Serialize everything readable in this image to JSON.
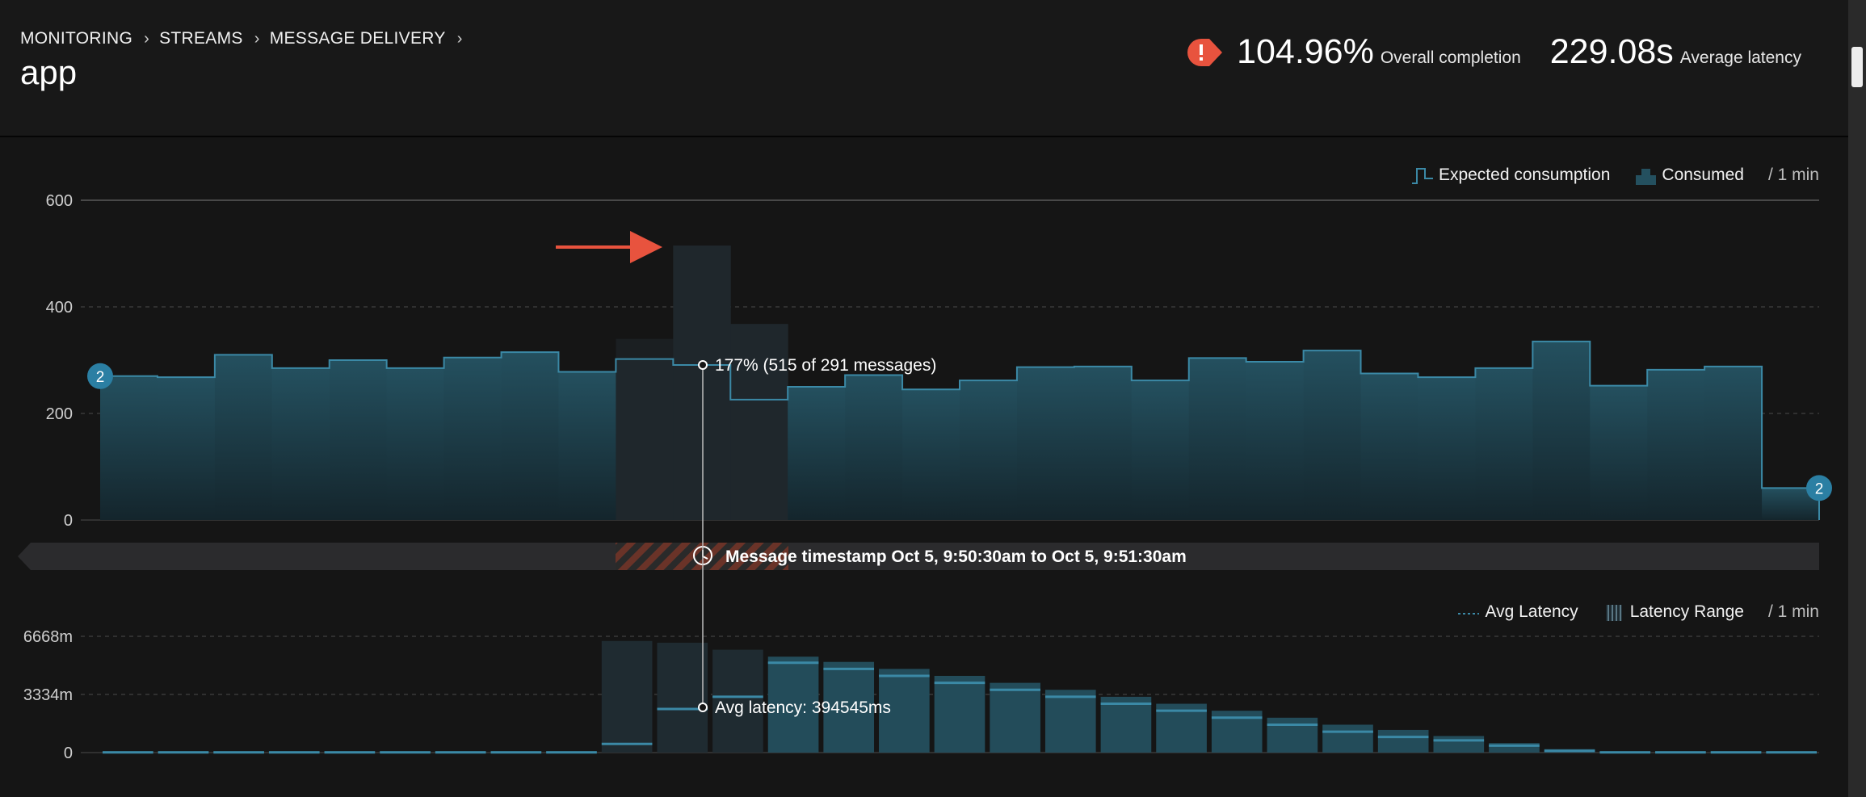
{
  "breadcrumb": [
    "MONITORING",
    "STREAMS",
    "MESSAGE DELIVERY"
  ],
  "page_title": "app",
  "stats": {
    "completion_value": "104.96%",
    "completion_label": "Overall completion",
    "latency_value": "229.08s",
    "latency_label": "Average latency"
  },
  "top_legend": {
    "expected": "Expected consumption",
    "consumed": "Consumed",
    "per": "/ 1 min"
  },
  "bottom_legend": {
    "avg": "Avg Latency",
    "range": "Latency Range",
    "per": "/ 1 min"
  },
  "timestamp_bar": "Message timestamp Oct 5, 9:50:30am to Oct 5, 9:51:30am",
  "tooltip_top": "177% (515 of 291 messages)",
  "tooltip_bottom": "Avg latency: 394545ms",
  "markers": [
    "2",
    "2"
  ],
  "colors": {
    "bar_top": "#24505f",
    "bar_bottom": "#173039",
    "line": "#3b89a6",
    "highlight": "#1f272c",
    "alert": "#e8533e",
    "marker": "#2b7fa3"
  },
  "chart_data": [
    {
      "type": "bar",
      "ylim": [
        0,
        600
      ],
      "yticks": [
        "600",
        "400",
        "200",
        "0"
      ],
      "ytick_values": [
        600,
        400,
        200,
        0
      ],
      "consumed": [
        270,
        268,
        310,
        285,
        300,
        285,
        305,
        315,
        278,
        302,
        515,
        368,
        250,
        272,
        245,
        262,
        287,
        288,
        262,
        304,
        297,
        318,
        275,
        268,
        285,
        335,
        252,
        282,
        288,
        60
      ],
      "expected": [
        270,
        268,
        310,
        285,
        300,
        285,
        305,
        315,
        278,
        302,
        291,
        226,
        250,
        272,
        245,
        262,
        287,
        288,
        262,
        304,
        297,
        318,
        275,
        268,
        285,
        335,
        252,
        282,
        288,
        60
      ],
      "highlight_index": 10
    },
    {
      "type": "bar",
      "unit": "ms",
      "ylim": [
        0,
        6668000
      ],
      "yticks": [
        "6668m",
        "3334m",
        "0"
      ],
      "ytick_values": [
        6668000,
        3334000,
        0
      ],
      "latency_max": [
        80000,
        80000,
        80000,
        80000,
        80000,
        80000,
        80000,
        80000,
        80000,
        6400000,
        6300000,
        5900000,
        5500000,
        5200000,
        4800000,
        4400000,
        4000000,
        3600000,
        3200000,
        2800000,
        2400000,
        2000000,
        1600000,
        1300000,
        950000,
        550000,
        200000,
        80000,
        80000,
        80000,
        80000
      ],
      "avg_latency": [
        10000,
        10000,
        10000,
        10000,
        10000,
        10000,
        10000,
        10000,
        10000,
        500000,
        2500000,
        3200000,
        5150000,
        4800000,
        4400000,
        4000000,
        3600000,
        3200000,
        2800000,
        2400000,
        2000000,
        1600000,
        1200000,
        900000,
        700000,
        400000,
        100000,
        10000,
        10000,
        10000,
        10000
      ]
    }
  ]
}
